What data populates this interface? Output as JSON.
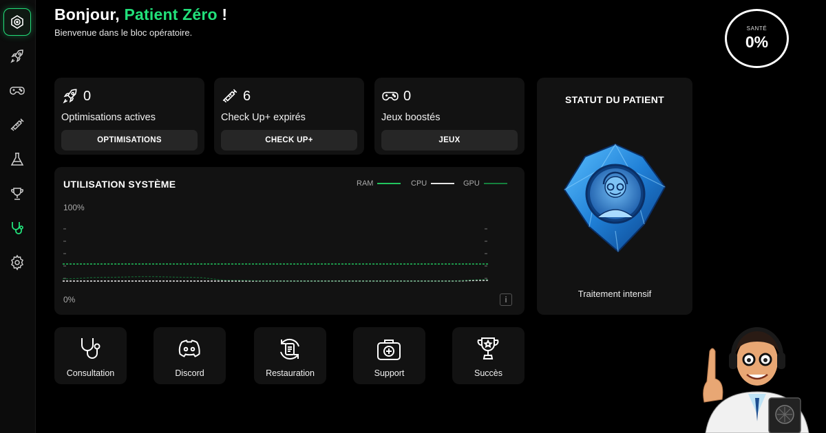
{
  "header": {
    "greeting_prefix": "Bonjour, ",
    "user_name": "Patient Zéro",
    "greeting_suffix": " !",
    "subtitle": "Bienvenue dans le bloc opératoire."
  },
  "health": {
    "label": "SANTÉ",
    "value": "0%"
  },
  "sidebar": {
    "items": [
      {
        "icon": "medical-kit-icon",
        "active": true
      },
      {
        "icon": "rocket-icon"
      },
      {
        "icon": "gamepad-icon"
      },
      {
        "icon": "syringe-icon"
      },
      {
        "icon": "flask-icon"
      },
      {
        "icon": "trophy-icon"
      },
      {
        "icon": "stethoscope-icon"
      },
      {
        "icon": "gear-icon"
      }
    ]
  },
  "stats": [
    {
      "icon": "rocket-icon",
      "count": "0",
      "label": "Optimisations actives",
      "button": "OPTIMISATIONS"
    },
    {
      "icon": "syringe-icon",
      "count": "6",
      "label": "Check Up+ expirés",
      "button": "CHECK UP+"
    },
    {
      "icon": "gamepad-icon",
      "count": "0",
      "label": "Jeux boostés",
      "button": "JEUX"
    }
  ],
  "usage": {
    "title": "UTILISATION SYSTÈME",
    "legend": [
      {
        "name": "RAM",
        "color": "#22c55e"
      },
      {
        "name": "CPU",
        "color": "#e5e5e5"
      },
      {
        "name": "GPU",
        "color": "#15803d"
      }
    ],
    "y_top_label": "100%",
    "y_bottom_label": "0%",
    "info_label": "i"
  },
  "chart_data": {
    "type": "line",
    "title": "UTILISATION SYSTÈME",
    "xlabel": "",
    "ylabel": "",
    "ylim": [
      0,
      100
    ],
    "grid": false,
    "legend_position": "top-right",
    "x": [
      0,
      1,
      2,
      3,
      4,
      5,
      6,
      7,
      8,
      9,
      10
    ],
    "series": [
      {
        "name": "RAM",
        "color": "#22c55e",
        "values": [
          36,
          36,
          36,
          36,
          36,
          36,
          36,
          36,
          36,
          36,
          36
        ]
      },
      {
        "name": "CPU",
        "color": "#e5e5e5",
        "values": [
          13,
          13,
          13,
          13,
          13,
          13,
          13,
          13,
          13,
          13,
          14
        ]
      },
      {
        "name": "GPU",
        "color": "#15803d",
        "values": [
          16,
          18,
          19,
          18,
          14,
          13,
          13,
          13,
          13,
          13,
          15
        ]
      }
    ]
  },
  "patient": {
    "title": "STATUT DU PATIENT",
    "status": "Traitement intensif"
  },
  "actions": [
    {
      "icon": "stethoscope-icon",
      "label": "Consultation"
    },
    {
      "icon": "discord-icon",
      "label": "Discord"
    },
    {
      "icon": "restore-icon",
      "label": "Restauration"
    },
    {
      "icon": "medical-kit-icon",
      "label": "Support"
    },
    {
      "icon": "trophy-icon",
      "label": "Succès"
    }
  ],
  "colors": {
    "accent": "#22e07a",
    "card": "#121212",
    "background": "#000000"
  }
}
